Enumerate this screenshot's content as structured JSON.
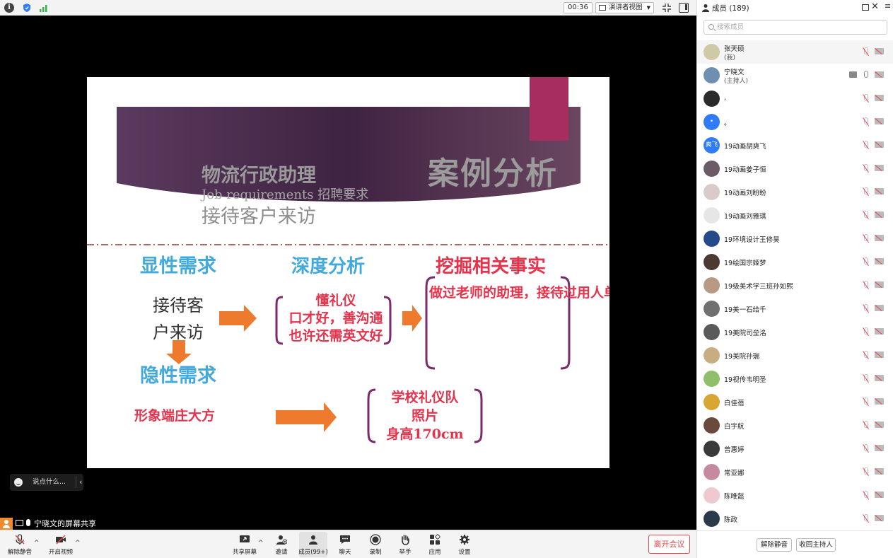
{
  "topbar": {
    "timer": "00:36",
    "view_mode": "演讲者视图"
  },
  "slide": {
    "title_cn": "物流行政助理",
    "title_en": "Job requirements 招聘要求",
    "title_cn2": "接待客户来访",
    "case_analysis": "案例分析",
    "heading_explicit": "显性需求",
    "heading_depth": "深度分析",
    "heading_facts": "挖掘相关事实",
    "receive_line1": "接待客",
    "receive_line2": "户来访",
    "heading_hidden": "隐性需求",
    "image_req": "形象端庄大方",
    "mid_block": "懂礼仪\n口才好，善沟通\n也许还需英文好",
    "right_block": "做过老师的助理，接待过用人单位来访主持人，化解危机认证、接待外宾、英文写作",
    "photo_block": "学校礼仪队\n照片\n身高170cm",
    "colors": {
      "banner": "#4a2a4a",
      "accent_box": "#a82d5f",
      "blue": "#41a9dc",
      "red": "#e5334c",
      "arrow": "#ee7a2d",
      "bracket": "#7b2a6e"
    }
  },
  "chat": {
    "placeholder": "说点什么..."
  },
  "share_label": "宁晓文的屏幕共享",
  "toolbar": {
    "unmute": "解除静音",
    "start_video": "开启视频",
    "share_screen": "共享屏幕",
    "invite": "邀请",
    "members": "成员(99+)",
    "chat": "聊天",
    "record": "录制",
    "raise_hand": "举手",
    "apps": "应用",
    "settings": "设置",
    "leave": "离开会议"
  },
  "panel": {
    "title": "成员 (189)",
    "search_placeholder": "搜索成员",
    "members": [
      {
        "name": "张天硕",
        "role": "(我)",
        "avatar_color": "#cfc9a6"
      },
      {
        "name": "宁晓文",
        "role": "(主持人)",
        "avatar_color": "#6f8fb0",
        "sharing": true
      },
      {
        "name": ",",
        "avatar_color": "#2b2b2b"
      },
      {
        "name": "。",
        "avatar_color": "#2f7cf6"
      },
      {
        "name": "19动画胡爽飞",
        "avatar_color": "#2f7cf6",
        "avatar_text": "爽飞"
      },
      {
        "name": "19动画姜子恒",
        "avatar_color": "#6b5b66"
      },
      {
        "name": "19动画刘盼盼",
        "avatar_color": "#d9cbcb"
      },
      {
        "name": "19动画刘雅琪",
        "avatar_color": "#e6e6e6"
      },
      {
        "name": "19环境设计王修昊",
        "avatar_color": "#244a8a"
      },
      {
        "name": "19绘国宗姬梦",
        "avatar_color": "#4a3a32"
      },
      {
        "name": "19级美术学三班孙如熙",
        "avatar_color": "#b89a84"
      },
      {
        "name": "19美一石给千",
        "avatar_color": "#707070"
      },
      {
        "name": "19美院司垒洺",
        "avatar_color": "#5a5a5a"
      },
      {
        "name": "19美院孙瑞",
        "avatar_color": "#c9ad82"
      },
      {
        "name": "19视传韦明圣",
        "avatar_color": "#8fbf6a"
      },
      {
        "name": "白佳蓓",
        "avatar_color": "#d8a632"
      },
      {
        "name": "白宇航",
        "avatar_color": "#6a4a3a"
      },
      {
        "name": "曾惠婷",
        "avatar_color": "#3a3a3a"
      },
      {
        "name": "常亚娜",
        "avatar_color": "#c48aa0"
      },
      {
        "name": "陈唯懿",
        "avatar_color": "#f0c8d0"
      },
      {
        "name": "陈政",
        "avatar_color": "#2a3a4a"
      }
    ],
    "footer_unmute": "解除静音",
    "footer_reclaim_host": "收回主持人"
  }
}
